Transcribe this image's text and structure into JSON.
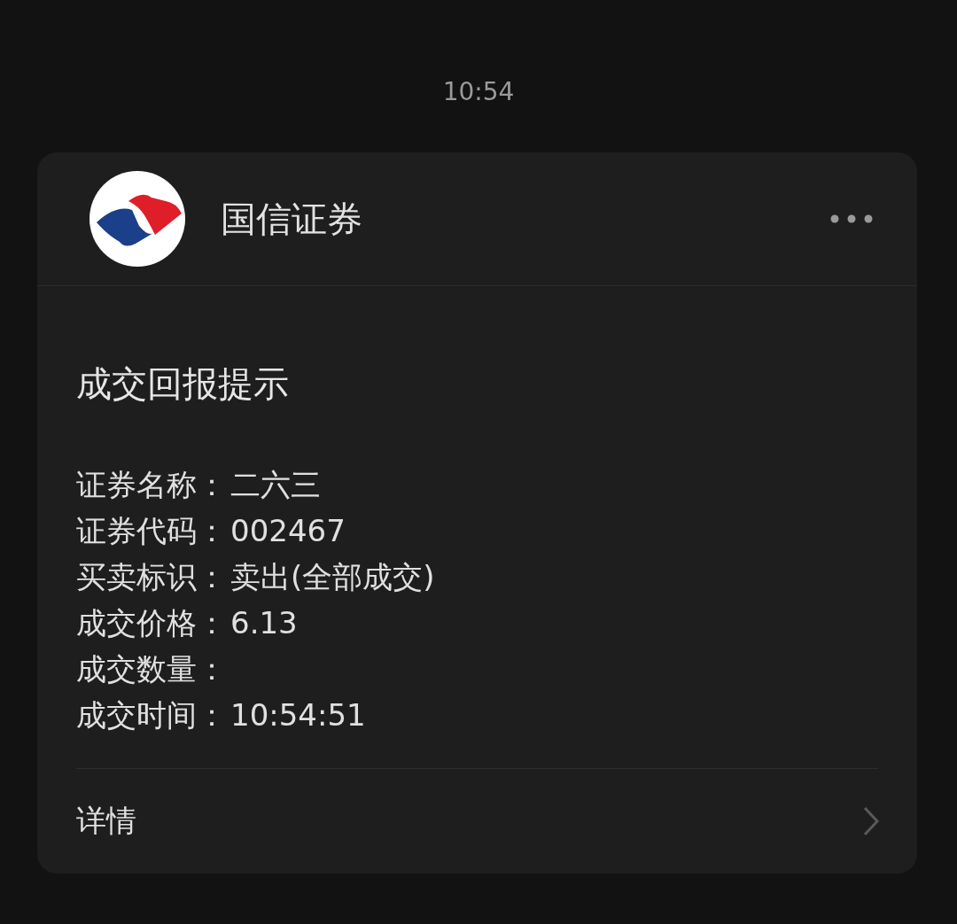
{
  "status_time": "10:54",
  "notification": {
    "app_name": "国信证券",
    "title": "成交回报提示",
    "lines": [
      {
        "label": "证券名称：",
        "value": "二六三"
      },
      {
        "label": "证券代码：",
        "value": "002467"
      },
      {
        "label": "买卖标识：",
        "value": "卖出(全部成交)"
      },
      {
        "label": "成交价格：",
        "value": "6.13"
      },
      {
        "label": "成交数量："
      },
      {
        "label": "成交时间：",
        "value": "10:54:51"
      }
    ],
    "action": "详情"
  }
}
